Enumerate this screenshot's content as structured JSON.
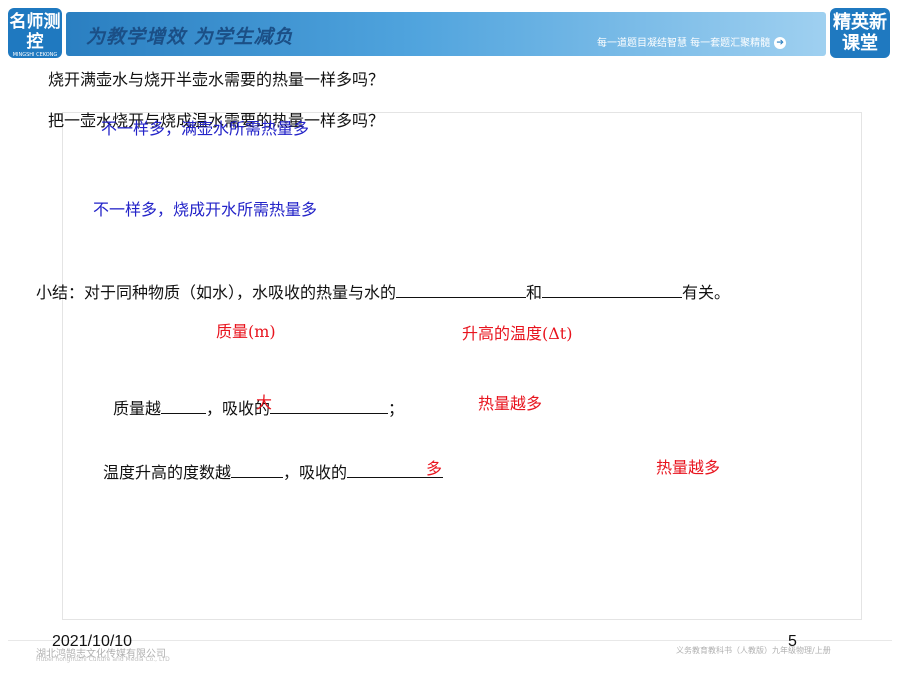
{
  "header": {
    "logo_left": "名师测控",
    "logo_left_sub": "MINGSHI CEKONG",
    "slogan": "为教学增效 为学生减负",
    "tagline": "每一道题目凝结智慧 每一套题汇聚精髓",
    "logo_right": "精英新课堂",
    "arrow_icon": "arrow-right-icon"
  },
  "content": {
    "question1": "烧开满壶水与烧开半壶水需要的热量一样多吗？",
    "question2": "把一壶水烧开与烧成温水需要的热量一样多吗？",
    "answer1": "不一样多，满壶水所需热量多",
    "answer2": "不一样多，烧成开水所需热量多",
    "summary_prefix": "小结：对于同种物质（如水），水吸收的热量与水的",
    "summary_and": "和",
    "summary_suffix": "有关。",
    "blank_answer_mass": "质量(m)",
    "blank_answer_temp": "升高的温度(Δt)",
    "line_mass_prefix": "质量越",
    "line_mass_mid": "，吸收的",
    "line_mass_end": "；",
    "mass_fill_big": "大",
    "mass_fill_result": "热量越多",
    "line_temp_prefix": "温度升高的度数越",
    "line_temp_mid": "，吸收的",
    "temp_fill_more": "多",
    "temp_fill_result": "热量越多"
  },
  "footer": {
    "date": "2021/10/10",
    "page_number": "5",
    "company": "湖北鸿鹄志文化传媒有限公司",
    "company_en": "Hubei honghuzhi Culture and Media Co., LTD",
    "book": "义务教育教科书（人教版）九年级物理/上册"
  },
  "colors": {
    "answer_blue": "#2323c8",
    "answer_red": "#e8141e",
    "banner_blue": "#2a7fc1"
  }
}
